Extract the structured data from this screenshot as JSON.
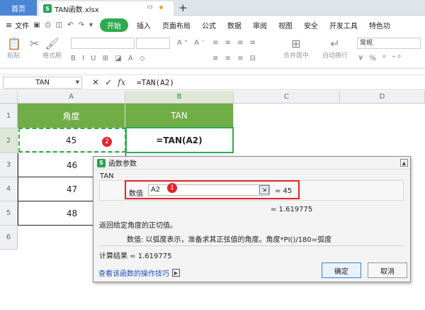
{
  "titlebar": {
    "home_tab": "首页",
    "file_tab": "TAN函数.xlsx",
    "file_icon": "S",
    "new_tab": "+"
  },
  "menubar": {
    "file_menu": "文件",
    "items": [
      "开始",
      "插入",
      "页面布局",
      "公式",
      "数据",
      "审阅",
      "视图",
      "安全",
      "开发工具",
      "特色功"
    ]
  },
  "ribbon": {
    "paste": "粘贴",
    "format_painter": "格式刷",
    "merge_center": "合并居中",
    "auto_wrap": "自动换行",
    "number_format": "常规"
  },
  "formula_bar": {
    "name_box": "TAN",
    "formula": "=TAN(A2)"
  },
  "sheet": {
    "columns": [
      "A",
      "B",
      "C",
      "D"
    ],
    "rows": [
      "1",
      "2",
      "3",
      "4",
      "5",
      "6"
    ],
    "header_a": "角度",
    "header_b": "TAN",
    "a_values": [
      "45",
      "46",
      "47",
      "48"
    ],
    "b2_formula": "=TAN(A2)",
    "badge_2": "2"
  },
  "dialog": {
    "title": "函数参数",
    "title_icon": "S",
    "function_name": "TAN",
    "arg_label": "数值",
    "arg_value": "A2",
    "arg_result": "= 45",
    "badge_1": "1",
    "result_preview": "= 1.619775",
    "description": "返回给定角度的正切值。",
    "arg_description": "数值:  以弧度表示，准备求其正弦值的角度。角度*PI()/180=弧度",
    "calc_result": "计算结果  =  1.619775",
    "help_link": "查看该函数的操作技巧",
    "ok_label": "确定",
    "cancel_label": "取消"
  },
  "colors": {
    "accent": "#2faa4f",
    "header_fill": "#70ad47",
    "badge": "#e3242b",
    "link": "#1f4eb4"
  }
}
